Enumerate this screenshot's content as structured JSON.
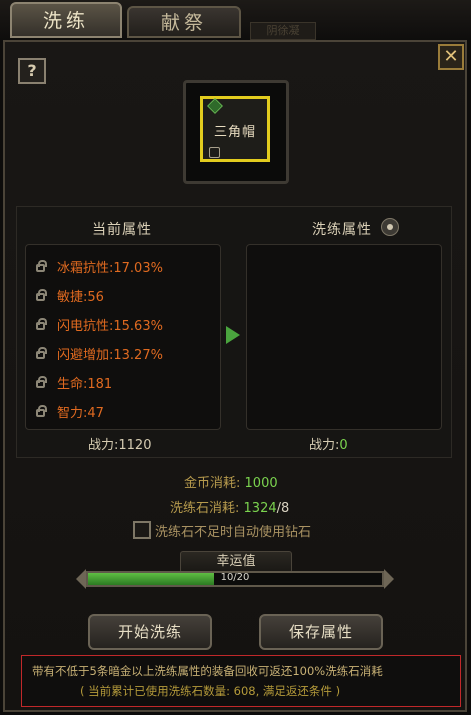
{
  "tabs": [
    {
      "label": "洗练",
      "active": true
    },
    {
      "label": "献祭",
      "active": false
    }
  ],
  "bg_tab_text": "阴徐凝",
  "help_label": "?",
  "close_label": "✕",
  "item": {
    "name": "三角帽"
  },
  "current": {
    "title": "当前属性",
    "attributes": [
      {
        "text": "冰霜抗性:17.03%"
      },
      {
        "text": "敏捷:56"
      },
      {
        "text": "闪电抗性:15.63%"
      },
      {
        "text": "闪避增加:13.27%"
      },
      {
        "text": "生命:181"
      },
      {
        "text": "智力:47"
      }
    ],
    "power_label": "战力:",
    "power_value": "1120"
  },
  "refine": {
    "title": "洗练属性",
    "power_label": "战力:",
    "power_value": "0"
  },
  "costs": {
    "gold_label": "金币消耗:",
    "gold_value": "1000",
    "stone_label": "洗练石消耗:",
    "stone_have": "1324",
    "stone_need": "/8"
  },
  "auto_diamond": {
    "label": "洗练石不足时自动使用钻石",
    "checked": false
  },
  "luck": {
    "title": "幸运值",
    "text": "10/20",
    "fraction": 0.43
  },
  "buttons": {
    "start": "开始洗练",
    "save": "保存属性"
  },
  "notice": {
    "line1": "带有不低于5条暗金以上洗练属性的装备回收可返还100%洗练石消耗",
    "line2": "( 当前累计已使用洗练石数量: 608, 满足返还条件 )"
  },
  "colors": {
    "attribute": "#e06a20",
    "accent_green": "#7bd34f",
    "slot_border": "#e2cc1e",
    "notice_border": "#c0282a"
  }
}
